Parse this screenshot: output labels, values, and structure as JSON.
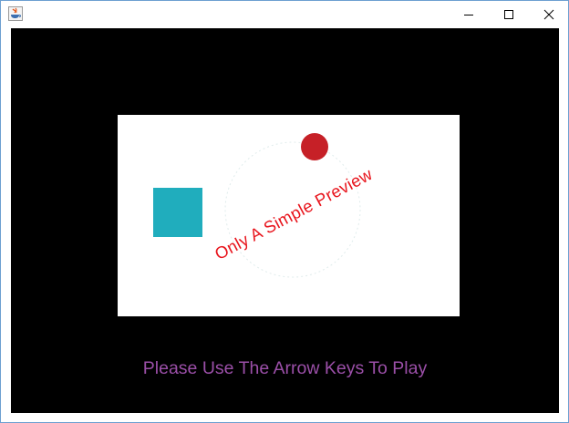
{
  "window": {
    "title": "",
    "controls": {
      "minimize_icon": "minimize-icon",
      "maximize_icon": "maximize-icon",
      "close_icon": "close-icon"
    }
  },
  "game": {
    "background_color": "#000000",
    "preview": {
      "background_color": "#ffffff",
      "caption": "Only A Simple Preview",
      "caption_color": "#e8141c",
      "player_square_color": "#20adbd",
      "ball_color": "#c62027",
      "orbit_color": "#e0ecec"
    },
    "instructions": "Please Use The Arrow Keys To Play",
    "instructions_color": "#9b4fa8"
  }
}
